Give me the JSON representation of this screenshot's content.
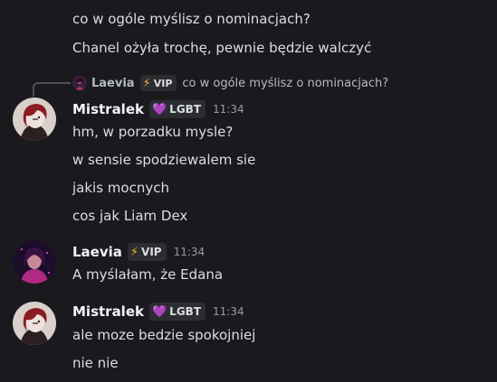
{
  "messages_top": [
    {
      "text": "co w ogóle myślisz o nominacjach?"
    },
    {
      "text": "Chanel ożyła trochę, pewnie będzie walczyć"
    }
  ],
  "reply_preview": {
    "author": "Laevia",
    "tag_icon": "lightning-icon",
    "tag": "VIP",
    "text": "co w ogóle myślisz o nominacjach?"
  },
  "groups": [
    {
      "author": "Mistralek",
      "tag_icon": "heart-icon",
      "tag": "LGBT",
      "time": "11:34",
      "lines": [
        "hm, w porzadku mysle?",
        "w sensie spodziewalem sie",
        "jakis mocnych",
        "cos jak Liam Dex"
      ]
    },
    {
      "author": "Laevia",
      "tag_icon": "lightning-icon",
      "tag": "VIP",
      "time": "11:34",
      "lines": [
        "A myślałam, że Edana"
      ]
    },
    {
      "author": "Mistralek",
      "tag_icon": "heart-icon",
      "tag": "LGBT",
      "time": "11:34",
      "lines": [
        "ale moze bedzie spokojniej",
        "nie nie"
      ]
    }
  ],
  "colors": {
    "background": "#1a1a1e",
    "text": "#dbdee1",
    "username": "#f2f3f5",
    "timestamp": "#949ba4",
    "tag_bg": "#2b2d31",
    "heart": "#e879f9",
    "bolt": "#f0b232"
  }
}
